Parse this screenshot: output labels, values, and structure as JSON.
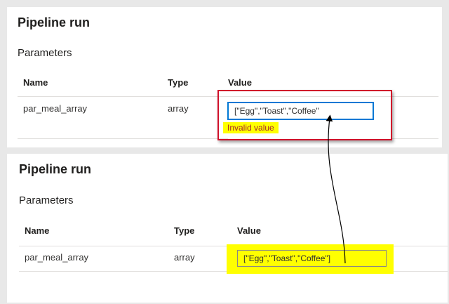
{
  "top": {
    "title": "Pipeline run",
    "section": "Parameters",
    "columns": {
      "name": "Name",
      "type": "Type",
      "value": "Value"
    },
    "row": {
      "name": "par_meal_array",
      "type": "array",
      "value": "[\"Egg\",\"Toast\",\"Coffee\""
    },
    "error": "Invalid value"
  },
  "bottom": {
    "title": "Pipeline run",
    "section": "Parameters",
    "columns": {
      "name": "Name",
      "type": "Type",
      "value": "Value"
    },
    "row": {
      "name": "par_meal_array",
      "type": "array",
      "value": "[\"Egg\",\"Toast\",\"Coffee\"]"
    }
  },
  "colors": {
    "error_frame": "#d0102a",
    "highlight": "#ffff00",
    "input_focus_border": "#0078d4",
    "error_text": "#a4262c"
  }
}
